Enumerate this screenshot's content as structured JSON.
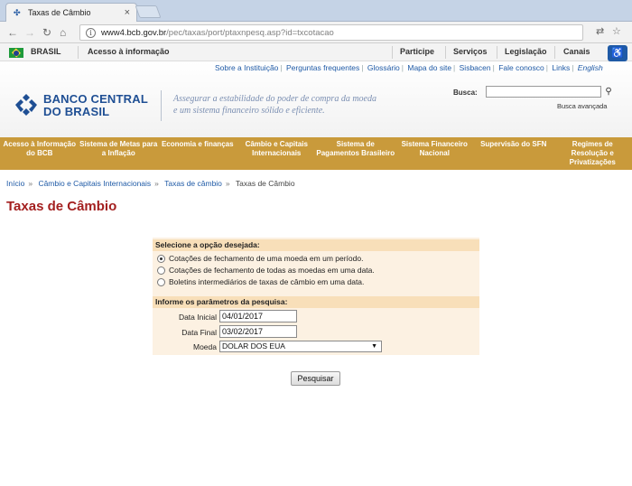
{
  "browser": {
    "tab_title": "Taxas de Câmbio",
    "url_host": "www4.bcb.gov.br",
    "url_path": "/pec/taxas/port/ptaxnpesq.asp?id=txcotacao"
  },
  "govbar": {
    "country": "BRASIL",
    "access": "Acesso à informação",
    "links": [
      "Participe",
      "Serviços",
      "Legislação",
      "Canais"
    ]
  },
  "toplinks": [
    "Sobre a Instituição",
    "Perguntas frequentes",
    "Glossário",
    "Mapa do site",
    "Sisbacen",
    "Fale conosco",
    "Links",
    "English"
  ],
  "header": {
    "logo_line1": "BANCO CENTRAL",
    "logo_line2": "DO BRASIL",
    "slogan_line1": "Assegurar a estabilidade do poder de compra da moeda",
    "slogan_line2": "e um sistema financeiro sólido e eficiente.",
    "search_label": "Busca:",
    "search_value": "",
    "advanced_search": "Busca avançada"
  },
  "menu": [
    "Acesso à Informação do BCB",
    "Sistema de Metas para a Inflação",
    "Economia e finanças",
    "Câmbio e Capitais Internacionais",
    "Sistema de Pagamentos Brasileiro",
    "Sistema Financeiro Nacional",
    "Supervisão do SFN",
    "Regimes de Resolução e Privatizações"
  ],
  "breadcrumb": [
    "Início",
    "Câmbio e Capitais Internacionais",
    "Taxas de câmbio",
    "Taxas de Câmbio"
  ],
  "page_title": "Taxas de Câmbio",
  "form": {
    "section1_title": "Selecione a opção desejada:",
    "options": [
      "Cotações de fechamento de uma moeda em um período.",
      "Cotações de fechamento de todas as moedas em uma data.",
      "Boletins intermediários de taxas de câmbio em uma data."
    ],
    "selected_option": 0,
    "section2_title": "Informe os parâmetros da pesquisa:",
    "start_label": "Data Inicial",
    "start_value": "04/01/2017",
    "end_label": "Data Final",
    "end_value": "03/02/2017",
    "currency_label": "Moeda",
    "currency_value": "DOLAR DOS EUA",
    "submit_label": "Pesquisar"
  },
  "colors": {
    "menu_bg": "#c99a3b",
    "title_red": "#a31f1f",
    "link_blue": "#1f5aa6",
    "panel_bg": "#fcf1e2",
    "panel_head": "#f8dfb9"
  }
}
